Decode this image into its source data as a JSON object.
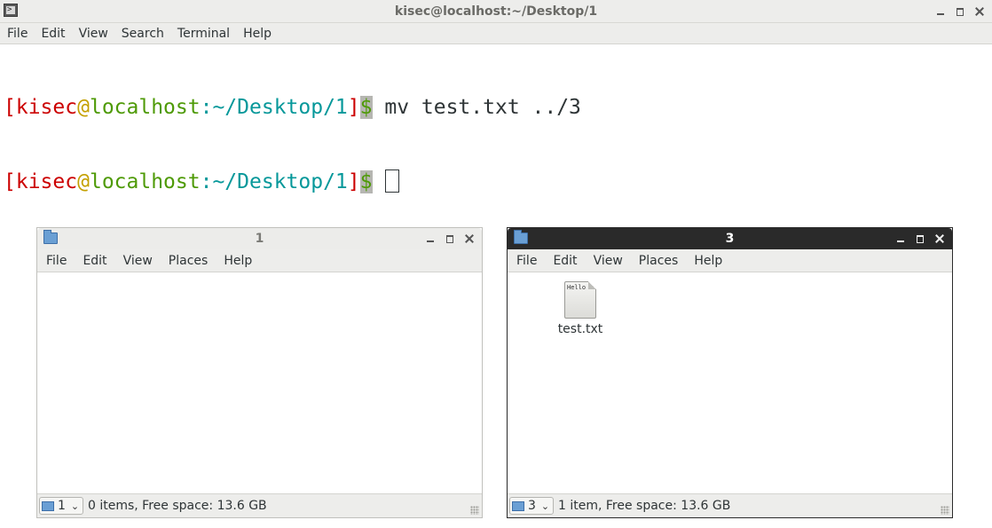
{
  "terminal": {
    "title": "kisec@localhost:~/Desktop/1",
    "menu": [
      "File",
      "Edit",
      "View",
      "Search",
      "Terminal",
      "Help"
    ],
    "lines": [
      {
        "bracket_open": "[",
        "user": "kisec",
        "at": "@",
        "host": "localhost",
        "colon": ":",
        "path": "~/Desktop/1",
        "bracket_close": "]",
        "dollar": "$",
        "command": " mv test.txt ../3"
      },
      {
        "bracket_open": "[",
        "user": "kisec",
        "at": "@",
        "host": "localhost",
        "colon": ":",
        "path": "~/Desktop/1",
        "bracket_close": "]",
        "dollar": "$",
        "command": " "
      }
    ]
  },
  "left_window": {
    "title": "1",
    "menu": [
      "File",
      "Edit",
      "View",
      "Places",
      "Help"
    ],
    "path_combo": "1",
    "status": "0 items, Free space: 13.6 GB",
    "files": []
  },
  "right_window": {
    "title": "3",
    "menu": [
      "File",
      "Edit",
      "View",
      "Places",
      "Help"
    ],
    "path_combo": "3",
    "status": "1 item, Free space: 13.6 GB",
    "files": [
      {
        "name": "test.txt",
        "preview": "Hello",
        "icon": "text-file-icon"
      }
    ]
  },
  "colors": {
    "prompt_red": "#cc0000",
    "prompt_olive": "#c4a000",
    "prompt_green": "#4e9a06",
    "prompt_cyan": "#06989a",
    "active_titlebar": "#2a2a2a",
    "folder_blue": "#6a9fd4"
  }
}
